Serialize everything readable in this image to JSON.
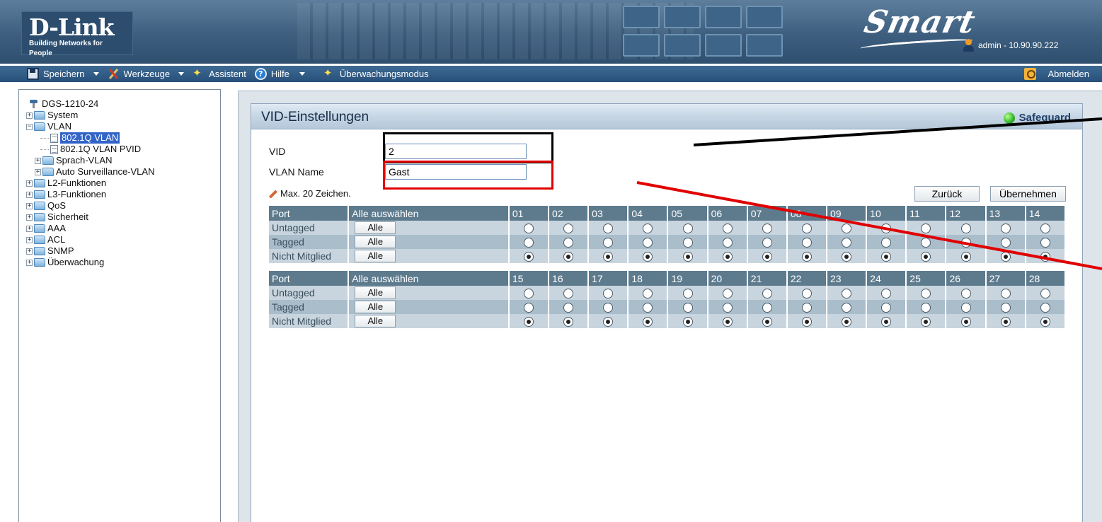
{
  "header": {
    "brand": "D-Link",
    "tagline": "Building Networks for People",
    "product": "Smart",
    "user_info": "admin - 10.90.90.222"
  },
  "toolbar": {
    "save": "Speichern",
    "tools": "Werkzeuge",
    "wizard": "Assistent",
    "help": "Hilfe",
    "monitoring": "Überwachungsmodus",
    "logout": "Abmelden"
  },
  "sidebar": {
    "root": "DGS-1210-24",
    "items": [
      {
        "label": "System"
      },
      {
        "label": "VLAN"
      },
      {
        "label": "802.1Q VLAN"
      },
      {
        "label": "802.1Q VLAN PVID"
      },
      {
        "label": "Sprach-VLAN"
      },
      {
        "label": "Auto Surveillance-VLAN"
      },
      {
        "label": "L2-Funktionen"
      },
      {
        "label": "L3-Funktionen"
      },
      {
        "label": "QoS"
      },
      {
        "label": "Sicherheit"
      },
      {
        "label": "AAA"
      },
      {
        "label": "ACL"
      },
      {
        "label": "SNMP"
      },
      {
        "label": "Überwachung"
      }
    ]
  },
  "panel": {
    "title": "VID-Einstellungen",
    "safeguard": "Safeguard",
    "vid_label": "VID",
    "vid_value": "2",
    "name_label": "VLAN Name",
    "name_value": "Gast",
    "hint": "Max. 20 Zeichen.",
    "back_button": "Zurück",
    "apply_button": "Übernehmen"
  },
  "port_table": {
    "header_port": "Port",
    "header_select_all": "Alle auswählen",
    "row_labels": [
      "Untagged",
      "Tagged",
      "Nicht Mitglied"
    ],
    "all_button": "Alle",
    "groups": [
      {
        "ports": [
          "01",
          "02",
          "03",
          "04",
          "05",
          "06",
          "07",
          "08",
          "09",
          "10",
          "11",
          "12",
          "13",
          "14"
        ]
      },
      {
        "ports": [
          "15",
          "16",
          "17",
          "18",
          "19",
          "20",
          "21",
          "22",
          "23",
          "24",
          "25",
          "26",
          "27",
          "28"
        ]
      }
    ],
    "selected_membership": "Nicht Mitglied"
  },
  "colors": {
    "header_bg": "#3d5e7e",
    "toolbar_bg": "#27507a",
    "table_header": "#5e7b8e",
    "selection": "#3264c8",
    "annotation_black": "#000000",
    "annotation_red": "#e00000"
  }
}
